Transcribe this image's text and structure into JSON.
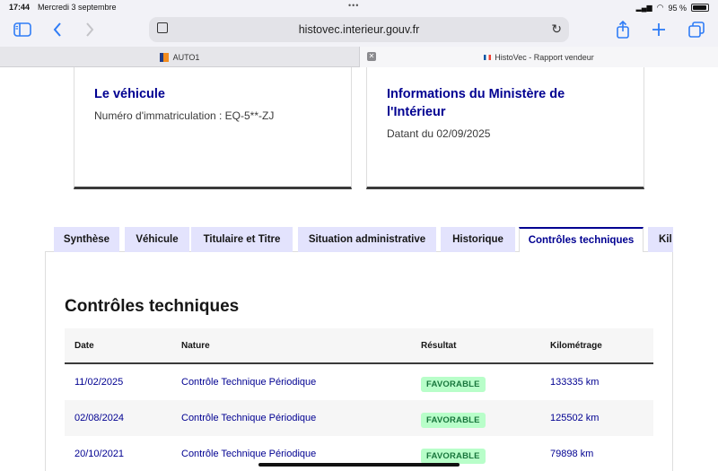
{
  "status_bar": {
    "time": "17:44",
    "date": "Mercredi 3 septembre",
    "battery": "95 %"
  },
  "browser": {
    "url": "histovec.interieur.gouv.fr",
    "tabs": [
      {
        "label": "AUTO1"
      },
      {
        "label": "HistoVec - Rapport vendeur"
      }
    ]
  },
  "cards": {
    "vehicle": {
      "title": "Le véhicule",
      "plate": "Numéro d'immatriculation : EQ-5**-ZJ"
    },
    "ministry": {
      "title_line1": "Informations du Ministère de",
      "title_line2": "l'Intérieur",
      "date": "Datant du 02/09/2025"
    }
  },
  "tabs": [
    {
      "label": "Synthèse"
    },
    {
      "label": "Véhicule"
    },
    {
      "label": "Titulaire et Titre"
    },
    {
      "label": "Situation administrative"
    },
    {
      "label": "Historique"
    },
    {
      "label": "Contrôles techniques"
    },
    {
      "label": "Kil"
    }
  ],
  "section": {
    "title": "Contrôles techniques"
  },
  "table": {
    "headers": [
      "Date",
      "Nature",
      "Résultat",
      "Kilométrage"
    ],
    "rows": [
      {
        "date": "11/02/2025",
        "nature": "Contrôle Technique Périodique",
        "result": "FAVORABLE",
        "km": "133335 km"
      },
      {
        "date": "02/08/2024",
        "nature": "Contrôle Technique Périodique",
        "result": "FAVORABLE",
        "km": "125502 km"
      },
      {
        "date": "20/10/2021",
        "nature": "Contrôle Technique Périodique",
        "result": "FAVORABLE",
        "km": "79898 km"
      }
    ]
  },
  "colors": {
    "accent": "#000091",
    "badge_bg": "#b8fec9",
    "badge_text": "#18753c",
    "tab_bg": "#e3e3fd"
  }
}
